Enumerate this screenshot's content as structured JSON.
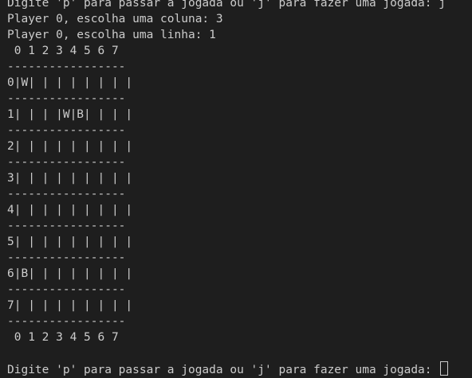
{
  "terminal": {
    "lines": [
      "Digite 'p' para passar a jogada ou 'j' para fazer uma jogada: j",
      "Player 0, escolha uma coluna: 3",
      "Player 0, escolha uma linha: 1",
      " 0 1 2 3 4 5 6 7",
      "-----------------",
      "0|W| | | | | | | |",
      "-----------------",
      "1| | | |W|B| | | |",
      "-----------------",
      "2| | | | | | | | |",
      "-----------------",
      "3| | | | | | | | |",
      "-----------------",
      "4| | | | | | | | |",
      "-----------------",
      "5| | | | | | | | |",
      "-----------------",
      "6|B| | | | | | | |",
      "-----------------",
      "7| | | | | | | | |",
      "-----------------",
      " 0 1 2 3 4 5 6 7",
      "",
      "Digite 'p' para passar a jogada ou 'j' para fazer uma jogada: "
    ]
  }
}
